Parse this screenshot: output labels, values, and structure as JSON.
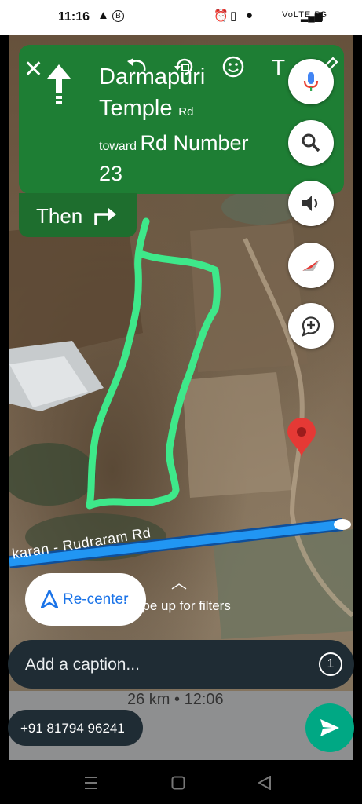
{
  "status_bar": {
    "time": "11:16",
    "left_icons": [
      "navigation-arrow-icon",
      "b-badge-icon"
    ],
    "right_icons": [
      "alarm-icon",
      "vibrate-icon",
      "location-icon",
      "volte-icon",
      "signal-icon",
      "battery-icon"
    ],
    "network_text": "VoLTE 5G"
  },
  "navigation": {
    "street_line1": "Darmapuri",
    "street_line2": "Temple",
    "street_suffix": "Rd",
    "toward_prefix": "toward",
    "toward_street": "Rd Number",
    "toward_street_line2": "23",
    "then_label": "Then",
    "card_color": "#1e7e34"
  },
  "editor": {
    "tools": [
      "undo-icon",
      "rotate-icon",
      "emoji-icon",
      "text-icon",
      "pencil-icon"
    ],
    "text_tool": "T"
  },
  "map": {
    "road_label": "karan - Rudraram Rd",
    "recenter_label": "Re-center",
    "swipe_hint": "Swipe up for filters",
    "route_color": "#3ee88a",
    "road_color": "#2196f3",
    "pin_color": "#e53935",
    "trip_summary": "26 km  •  12:06"
  },
  "side_buttons": [
    "mic-icon",
    "search-icon",
    "volume-icon",
    "compass-icon",
    "report-incident-icon"
  ],
  "composer": {
    "caption_placeholder": "Add a caption...",
    "view_once_label": "1",
    "recipient": "+91 81794 96241"
  },
  "system_nav": [
    "menu-icon",
    "home-icon",
    "back-icon"
  ]
}
